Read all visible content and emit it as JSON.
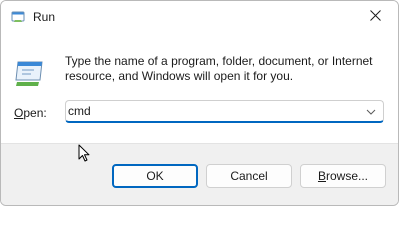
{
  "window": {
    "title": "Run",
    "title_icon": "run-app-icon"
  },
  "titlebar": {
    "close_icon": "close-icon"
  },
  "content": {
    "run_icon": "run-dialog-icon",
    "description": "Type the name of a program, folder, document, or Internet resource, and Windows will open it for you.",
    "open_label_accel": "O",
    "open_label_rest": "pen:",
    "open_value": "cmd",
    "dropdown_icon": "chevron-down-icon"
  },
  "footer": {
    "ok_label": "OK",
    "cancel_label": "Cancel",
    "browse_label_accel": "B",
    "browse_label_rest": "rowse..."
  },
  "colors": {
    "accent": "#0067c0",
    "footer_bg": "#f0f0f0",
    "text": "#1b1b1b"
  }
}
